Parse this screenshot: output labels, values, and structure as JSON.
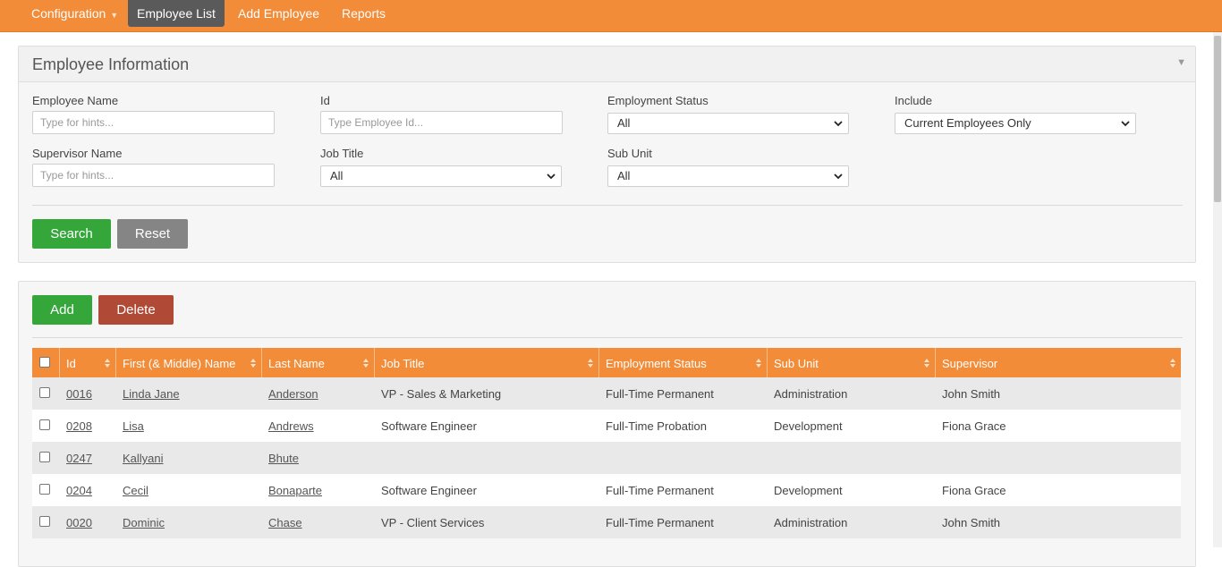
{
  "nav": {
    "items": [
      {
        "label": "Configuration",
        "has_caret": true
      },
      {
        "label": "Employee List",
        "active": true
      },
      {
        "label": "Add Employee"
      },
      {
        "label": "Reports"
      }
    ]
  },
  "search_panel": {
    "title": "Employee Information",
    "fields": {
      "employee_name": {
        "label": "Employee Name",
        "placeholder": "Type for hints..."
      },
      "id": {
        "label": "Id",
        "placeholder": "Type Employee Id..."
      },
      "employment_status": {
        "label": "Employment Status",
        "value": "All"
      },
      "include": {
        "label": "Include",
        "value": "Current Employees Only"
      },
      "supervisor_name": {
        "label": "Supervisor Name",
        "placeholder": "Type for hints..."
      },
      "job_title": {
        "label": "Job Title",
        "value": "All"
      },
      "sub_unit": {
        "label": "Sub Unit",
        "value": "All"
      }
    },
    "buttons": {
      "search": "Search",
      "reset": "Reset"
    }
  },
  "list_panel": {
    "buttons": {
      "add": "Add",
      "delete": "Delete"
    },
    "columns": [
      "Id",
      "First (& Middle) Name",
      "Last Name",
      "Job Title",
      "Employment Status",
      "Sub Unit",
      "Supervisor"
    ],
    "rows": [
      {
        "id": "0016",
        "first": "Linda Jane",
        "last": "Anderson",
        "job": "VP - Sales & Marketing",
        "status": "Full-Time Permanent",
        "unit": "Administration",
        "supervisor": "John Smith"
      },
      {
        "id": "0208",
        "first": "Lisa",
        "last": "Andrews",
        "job": "Software Engineer",
        "status": "Full-Time Probation",
        "unit": "Development",
        "supervisor": "Fiona Grace"
      },
      {
        "id": "0247",
        "first": "Kallyani",
        "last": "Bhute",
        "job": "",
        "status": "",
        "unit": "",
        "supervisor": ""
      },
      {
        "id": "0204",
        "first": "Cecil",
        "last": "Bonaparte",
        "job": "Software Engineer",
        "status": "Full-Time Permanent",
        "unit": "Development",
        "supervisor": "Fiona Grace"
      },
      {
        "id": "0020",
        "first": "Dominic",
        "last": "Chase",
        "job": "VP - Client Services",
        "status": "Full-Time Permanent",
        "unit": "Administration",
        "supervisor": "John Smith"
      }
    ]
  },
  "colors": {
    "brand_orange": "#f28c38",
    "active_nav": "#5a5a5a",
    "green_button": "#35a63a",
    "grey_button": "#858585",
    "red_button": "#b04a36"
  }
}
